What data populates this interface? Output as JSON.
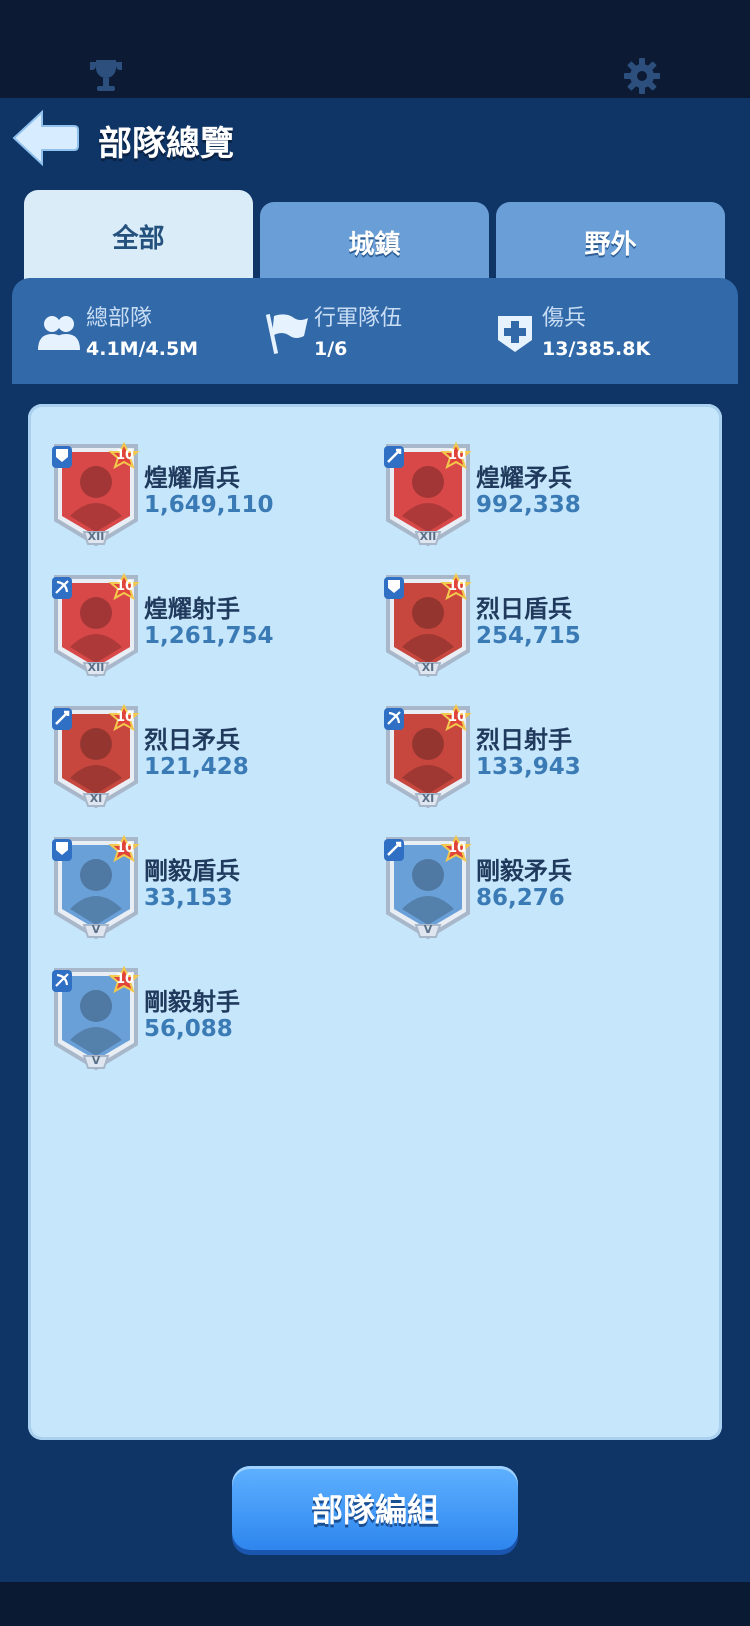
{
  "header": {
    "title": "部隊總覽"
  },
  "tabs": [
    {
      "label": "全部",
      "active": true
    },
    {
      "label": "城鎮",
      "active": false
    },
    {
      "label": "野外",
      "active": false
    }
  ],
  "stats": [
    {
      "label": "總部隊",
      "value": "4.1M/4.5M",
      "icon": "troops-icon"
    },
    {
      "label": "行軍隊伍",
      "value": "1/6",
      "icon": "flag-icon"
    },
    {
      "label": "傷兵",
      "value": "13/385.8K",
      "icon": "medical-cross-icon"
    }
  ],
  "units": [
    {
      "name": "煌耀盾兵",
      "count": "1,649,110",
      "level": "10",
      "tier": "XII",
      "type": "shield",
      "color": "#d94848"
    },
    {
      "name": "煌耀矛兵",
      "count": "992,338",
      "level": "10",
      "tier": "XII",
      "type": "spear",
      "color": "#d94848"
    },
    {
      "name": "煌耀射手",
      "count": "1,261,754",
      "level": "10",
      "tier": "XII",
      "type": "archer",
      "color": "#d94848"
    },
    {
      "name": "烈日盾兵",
      "count": "254,715",
      "level": "10",
      "tier": "XI",
      "type": "shield",
      "color": "#c7473f"
    },
    {
      "name": "烈日矛兵",
      "count": "121,428",
      "level": "10",
      "tier": "XI",
      "type": "spear",
      "color": "#c7473f"
    },
    {
      "name": "烈日射手",
      "count": "133,943",
      "level": "10",
      "tier": "XI",
      "type": "archer",
      "color": "#c7473f"
    },
    {
      "name": "剛毅盾兵",
      "count": "33,153",
      "level": "10",
      "tier": "V",
      "type": "shield",
      "color": "#6aa0d8"
    },
    {
      "name": "剛毅矛兵",
      "count": "86,276",
      "level": "10",
      "tier": "V",
      "type": "spear",
      "color": "#6aa0d8"
    },
    {
      "name": "剛毅射手",
      "count": "56,088",
      "level": "10",
      "tier": "V",
      "type": "archer",
      "color": "#6aa0d8"
    }
  ],
  "footer": {
    "button_label": "部隊編組"
  }
}
